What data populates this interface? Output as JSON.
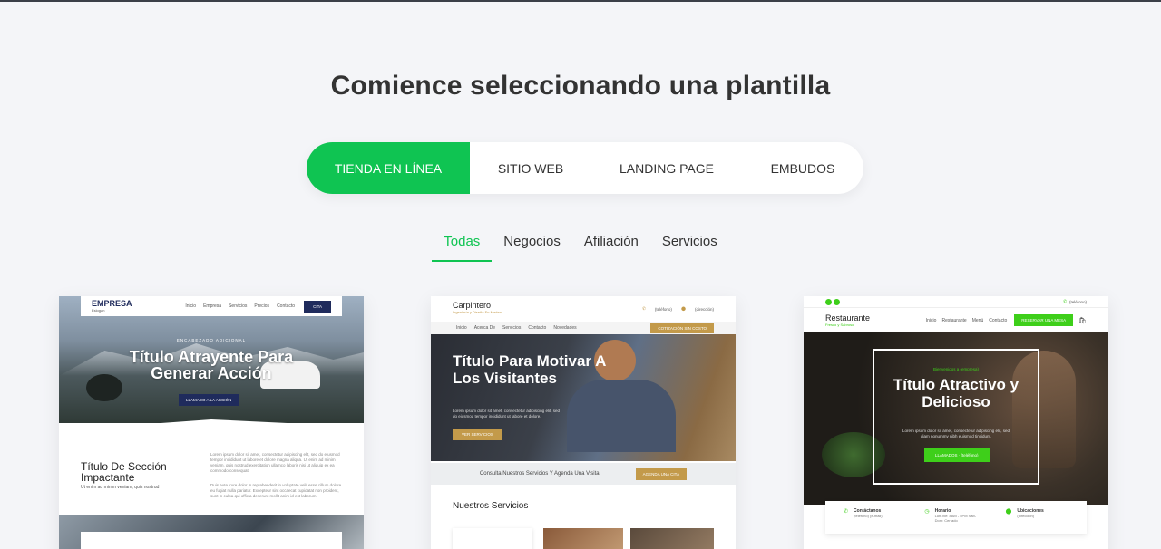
{
  "page": {
    "heading": "Comience seleccionando una plantilla"
  },
  "mode_tabs": [
    {
      "label": "TIENDA EN LÍNEA",
      "active": true
    },
    {
      "label": "SITIO WEB",
      "active": false
    },
    {
      "label": "LANDING PAGE",
      "active": false
    },
    {
      "label": "EMBUDOS",
      "active": false
    }
  ],
  "category_tabs": [
    {
      "label": "Todas",
      "active": true
    },
    {
      "label": "Negocios",
      "active": false
    },
    {
      "label": "Afiliación",
      "active": false
    },
    {
      "label": "Servicios",
      "active": false
    }
  ],
  "colors": {
    "accent": "#0fc452",
    "navy": "#1f2b5c",
    "gold": "#c39a4a",
    "lime": "#3ecf1a"
  },
  "templates": [
    {
      "brand": "EMPRESA",
      "brand_sub": "Eslogan",
      "nav": [
        "Inicio",
        "Empresa",
        "Servicios",
        "Precios",
        "Contacto"
      ],
      "nav_button": "CITA",
      "hero_kicker": "ENCABEZADO ADICIONAL",
      "hero_title": "Título Atrayente Para Generar Acción",
      "hero_button": "LLAMADO A LA ACCIÓN",
      "section_title": "Título De Sección Impactante",
      "section_sub": "Ut enim ad minim veniam, quis nostrud",
      "lorem_a": "Lorem ipsum dolor sit amet, consectetur adipiscing elit, sed do eiusmod tempor incididunt ut labore et dolore magna aliqua. Ut enim ad minim veniam, quis nostrud exercitation ullamco laboris nisi ut aliquip ex ea commodo consequat.",
      "lorem_b": "Duis aute irure dolor in reprehenderit in voluptate velit esse cillum dolore eu fugiat nulla pariatur. Excepteur sint occaecat cupidatat non proident, sunt in culpa qui officia deserunt mollit anim id est laborum."
    },
    {
      "brand": "Carpintero",
      "brand_sub": "Ingeniería y Diseño En Madera",
      "phone": "(teléfono)",
      "address": "(dirección)",
      "nav": [
        "Inicio",
        "Acerca De",
        "Servicios",
        "Contacto",
        "Novedades"
      ],
      "nav_button": "COTIZACIÓN SIN COSTO",
      "hero_title": "Título Para Motivar A Los Visitantes",
      "hero_body": "Lorem ipsum dolor sit amet, consectetur adipiscing elit, sed do eiusmod tempor incididunt ut labore et dolore.",
      "hero_button": "VER SERVICIOS",
      "band_text": "Consulta Nuestros Servicios Y Agenda Una Visita",
      "band_button": "AGENDA UNA CITA",
      "section_title": "Nuestros Servicios"
    },
    {
      "brand": "Restaurante",
      "brand_sub": "Fresco y Sabroso",
      "phone": "(teléfono)",
      "nav": [
        "Inicio",
        "Restaurante",
        "Menú",
        "Contacto"
      ],
      "nav_button": "RESERVAR UNA MESA",
      "hero_kicker": "Bienvenidos a (empresa)",
      "hero_title": "Título Atractivo y Delicioso",
      "hero_body": "Lorem ipsum dolor sit amet, consectetur adipiscing elit, sed diam nonummy nibh euismod tincidunt.",
      "hero_button": "LLAMADOS · (teléfono)",
      "info": [
        {
          "title": "Contáctanos",
          "lines": "(teléfono) (e-mail)"
        },
        {
          "title": "Horario",
          "lines": "Lun-Vie: 8AM - 5PM Sab-Dom: Cerrado"
        },
        {
          "title": "Ubicaciones",
          "lines": "(dirección)"
        }
      ]
    }
  ]
}
